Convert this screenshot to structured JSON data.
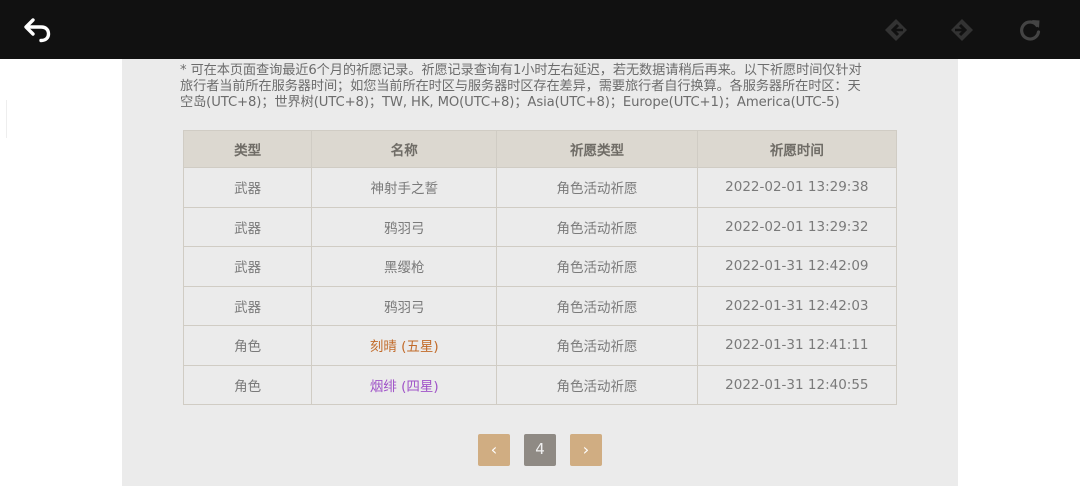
{
  "toolbar": {
    "back_icon": "undo-arrow-icon",
    "prev_icon": "diamond-arrow-left-icon",
    "next_icon": "diamond-arrow-right-icon",
    "refresh_icon": "refresh-icon"
  },
  "notice": {
    "lines": [
      "* 可在本页面查询最近6个月的祈愿记录。祈愿记录查询有1小时左右延迟，若无数据请稍后再来。以下祈愿时间仅针对",
      "旅行者当前所在服务器时间；如您当前所在时区与服务器时区存在差异，需要旅行者自行换算。各服务器所在时区：天",
      "空岛(UTC+8)；世界树(UTC+8)；TW, HK, MO(UTC+8)；Asia(UTC+8)；Europe(UTC+1)；America(UTC-5)"
    ]
  },
  "table": {
    "headers": [
      "类型",
      "名称",
      "祈愿类型",
      "祈愿时间"
    ],
    "rows": [
      {
        "type": "武器",
        "name": "神射手之誓",
        "wish_type": "角色活动祈愿",
        "time": "2022-02-01 13:29:38",
        "rarity": ""
      },
      {
        "type": "武器",
        "name": "鸦羽弓",
        "wish_type": "角色活动祈愿",
        "time": "2022-02-01 13:29:32",
        "rarity": ""
      },
      {
        "type": "武器",
        "name": "黑缨枪",
        "wish_type": "角色活动祈愿",
        "time": "2022-01-31 12:42:09",
        "rarity": ""
      },
      {
        "type": "武器",
        "name": "鸦羽弓",
        "wish_type": "角色活动祈愿",
        "time": "2022-01-31 12:42:03",
        "rarity": ""
      },
      {
        "type": "角色",
        "name": "刻晴 (五星)",
        "wish_type": "角色活动祈愿",
        "time": "2022-01-31 12:41:11",
        "rarity": "5"
      },
      {
        "type": "角色",
        "name": "烟绯 (四星)",
        "wish_type": "角色活动祈愿",
        "time": "2022-01-31 12:40:55",
        "rarity": "4"
      }
    ]
  },
  "pagination": {
    "prev_label": "‹",
    "current_page": "4",
    "next_label": "›"
  },
  "colors": {
    "topbar": "#111111",
    "panel": "#ebebeb",
    "header_row": "#dcd8d0",
    "five_star": "#c26b2a",
    "four_star": "#a054c8",
    "pager_arrow": "#d0ad82",
    "pager_current": "#8f8a84"
  }
}
